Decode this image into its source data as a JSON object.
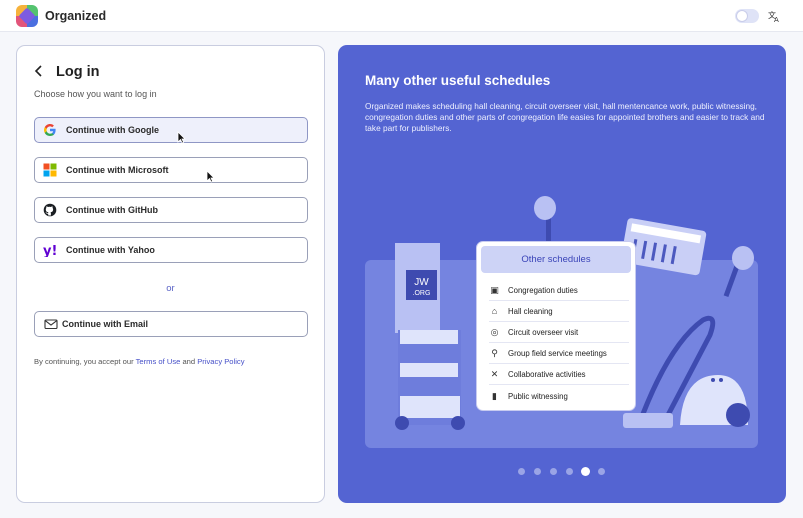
{
  "app": {
    "title": "Organized",
    "logo_icon": "organized-logo-icon"
  },
  "topbar": {
    "theme_toggle_icon": "theme-toggle-icon",
    "language_icon": "translate-icon"
  },
  "login": {
    "back_icon": "chevron-left-icon",
    "title": "Log in",
    "subtitle": "Choose how you want to log in",
    "providers": [
      {
        "label": "Continue with Google",
        "icon": "google-icon",
        "active": true
      },
      {
        "label": "Continue with Microsoft",
        "icon": "microsoft-icon",
        "active": false
      },
      {
        "label": "Continue with GitHub",
        "icon": "github-icon",
        "active": false
      },
      {
        "label": "Continue with Yahoo",
        "icon": "yahoo-icon",
        "active": false
      }
    ],
    "or_text": "or",
    "email_button": {
      "label": "Continue with Email",
      "icon": "mail-icon"
    },
    "terms": {
      "prefix": "By continuing, you accept our ",
      "terms_link": "Terms of Use",
      "conjunction": " and ",
      "privacy_link": "Privacy Policy"
    }
  },
  "promo": {
    "title": "Many other useful schedules",
    "text": "Organized makes scheduling hall cleaning, circuit overseer visit, hall mentencance work, public witnessing, congregation duties and other parts of congregation life easies for appointed brothers and easier to track and take part for publishers.",
    "illustration_badge": {
      "line1": "JW",
      "line2": ".ORG"
    },
    "card_title": "Other schedules",
    "schedules": [
      {
        "label": "Congregation duties",
        "icon": "clipboard-icon"
      },
      {
        "label": "Hall cleaning",
        "icon": "cleaning-icon"
      },
      {
        "label": "Circuit overseer visit",
        "icon": "visit-icon"
      },
      {
        "label": "Group field service meetings",
        "icon": "location-icon"
      },
      {
        "label": "Collaborative activities",
        "icon": "tools-icon"
      },
      {
        "label": "Public witnessing",
        "icon": "cart-icon"
      }
    ],
    "carousel": {
      "count": 6,
      "active_index": 4
    }
  },
  "colors": {
    "accent": "#5464d2",
    "link": "#4650c8",
    "panel_bg": "#5464d2"
  }
}
